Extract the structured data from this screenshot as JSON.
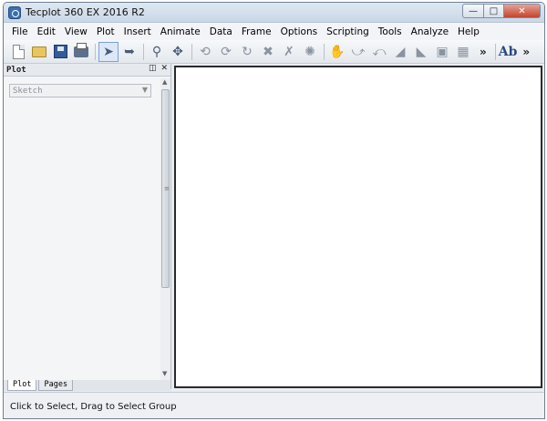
{
  "window": {
    "title": "Tecplot 360 EX 2016 R2"
  },
  "menu": [
    "File",
    "Edit",
    "View",
    "Plot",
    "Insert",
    "Animate",
    "Data",
    "Frame",
    "Options",
    "Scripting",
    "Tools",
    "Analyze",
    "Help"
  ],
  "toolbar": {
    "more_label": "»",
    "text_tool_label": "Ab",
    "icons": [
      "new-file-icon",
      "open-folder-icon",
      "save-icon",
      "print-icon",
      "select-arrow-icon",
      "adjust-icon",
      "zoom-icon",
      "translate-icon",
      "rotate-x-icon",
      "rotate-y-icon",
      "rotate-z-icon",
      "rollerball-icon",
      "spherical-rotate-icon",
      "twist-icon",
      "probe-icon",
      "extract-icon",
      "extract-points-icon",
      "slice-icon",
      "contour-icon",
      "image-icon",
      "geometry-icon"
    ]
  },
  "sidebar": {
    "title": "Plot",
    "plot_type": "Sketch",
    "tabs": [
      {
        "label": "Plot"
      },
      {
        "label": "Pages"
      }
    ]
  },
  "status": {
    "text": "Click to Select, Drag to Select Group"
  }
}
